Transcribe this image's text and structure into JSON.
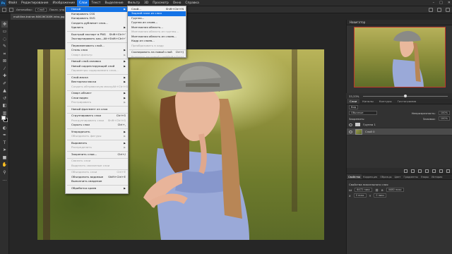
{
  "app": {
    "logo": "Ps"
  },
  "menubar": {
    "items": [
      "Файл",
      "Редактирование",
      "Изображение",
      "Слои",
      "Текст",
      "Выделение",
      "Фильтр",
      "3D",
      "Просмотр",
      "Окно",
      "Справка"
    ],
    "active_index": 3
  },
  "window_controls": [
    "–",
    "□",
    "✕"
  ],
  "options_bar": {
    "auto_select_label": "Автовыбор:",
    "auto_select_value": "Слой",
    "transform_label": "Показ. упр. элем."
  },
  "document_tab": {
    "title": "multiline-trainer-N0026CKXM-intro.jpg @ 33,3% (Слой 0, RGB/8#)"
  },
  "layer_menu": {
    "items": [
      {
        "label": "Новый",
        "shortcut": "",
        "submenu": true,
        "highlighted": true,
        "disabled": false
      },
      {
        "label": "Копировать CSS",
        "shortcut": "",
        "submenu": false,
        "highlighted": false,
        "disabled": false
      },
      {
        "label": "Копировать SVG",
        "shortcut": "",
        "submenu": false,
        "highlighted": false,
        "disabled": false
      },
      {
        "label": "Создать дубликат слоя...",
        "shortcut": "",
        "submenu": false,
        "highlighted": false,
        "disabled": false
      },
      {
        "label": "Удалить",
        "shortcut": "",
        "submenu": true,
        "highlighted": false,
        "disabled": false
      },
      {
        "sep": true
      },
      {
        "label": "Быстрый экспорт в PNG",
        "shortcut": "Shift+Ctrl+'",
        "submenu": false,
        "highlighted": false,
        "disabled": false
      },
      {
        "label": "Экспортировать как...",
        "shortcut": "Alt+Shift+Ctrl+'",
        "submenu": false,
        "highlighted": false,
        "disabled": false
      },
      {
        "sep": true
      },
      {
        "label": "Переименовать слой...",
        "shortcut": "",
        "submenu": false,
        "highlighted": false,
        "disabled": false
      },
      {
        "label": "Стиль слоя",
        "shortcut": "",
        "submenu": true,
        "highlighted": false,
        "disabled": false
      },
      {
        "label": "Смарт-фильтр",
        "shortcut": "",
        "submenu": true,
        "highlighted": false,
        "disabled": true
      },
      {
        "sep": true
      },
      {
        "label": "Новый слой-заливка",
        "shortcut": "",
        "submenu": true,
        "highlighted": false,
        "disabled": false
      },
      {
        "label": "Новый корректирующий слой",
        "shortcut": "",
        "submenu": true,
        "highlighted": false,
        "disabled": false
      },
      {
        "label": "Параметры содержимого слоя...",
        "shortcut": "",
        "submenu": false,
        "highlighted": false,
        "disabled": true
      },
      {
        "sep": true
      },
      {
        "label": "Слой-маска",
        "shortcut": "",
        "submenu": true,
        "highlighted": false,
        "disabled": false
      },
      {
        "label": "Векторная маска",
        "shortcut": "",
        "submenu": true,
        "highlighted": false,
        "disabled": false
      },
      {
        "label": "Создать обтравочную маску",
        "shortcut": "Alt+Ctrl+G",
        "submenu": false,
        "highlighted": false,
        "disabled": true
      },
      {
        "sep": true
      },
      {
        "label": "Смарт-объект",
        "shortcut": "",
        "submenu": true,
        "highlighted": false,
        "disabled": false
      },
      {
        "label": "Слои видео",
        "shortcut": "",
        "submenu": true,
        "highlighted": false,
        "disabled": false
      },
      {
        "label": "Растрировать",
        "shortcut": "",
        "submenu": true,
        "highlighted": false,
        "disabled": true
      },
      {
        "sep": true
      },
      {
        "label": "Новый фрагмент из слоя",
        "shortcut": "",
        "submenu": false,
        "highlighted": false,
        "disabled": false
      },
      {
        "sep": true
      },
      {
        "label": "Сгруппировать слои",
        "shortcut": "Ctrl+G",
        "submenu": false,
        "highlighted": false,
        "disabled": false
      },
      {
        "label": "Разгруппировать слои",
        "shortcut": "Shift+Ctrl+G",
        "submenu": false,
        "highlighted": false,
        "disabled": true
      },
      {
        "label": "Скрыть слои",
        "shortcut": "Ctrl+,",
        "submenu": false,
        "highlighted": false,
        "disabled": false
      },
      {
        "sep": true
      },
      {
        "label": "Упорядочить",
        "shortcut": "",
        "submenu": true,
        "highlighted": false,
        "disabled": false
      },
      {
        "label": "Объединить фигуры",
        "shortcut": "",
        "submenu": true,
        "highlighted": false,
        "disabled": true
      },
      {
        "sep": true
      },
      {
        "label": "Выровнять",
        "shortcut": "",
        "submenu": true,
        "highlighted": false,
        "disabled": false
      },
      {
        "label": "Распределить",
        "shortcut": "",
        "submenu": true,
        "highlighted": false,
        "disabled": true
      },
      {
        "sep": true
      },
      {
        "label": "Закрепить слои...",
        "shortcut": "Ctrl+/",
        "submenu": false,
        "highlighted": false,
        "disabled": false
      },
      {
        "sep": true
      },
      {
        "label": "Связать слои",
        "shortcut": "",
        "submenu": false,
        "highlighted": false,
        "disabled": true
      },
      {
        "label": "Выделить связанные слои",
        "shortcut": "",
        "submenu": false,
        "highlighted": false,
        "disabled": true
      },
      {
        "sep": true
      },
      {
        "label": "Объединить слои",
        "shortcut": "Ctrl+E",
        "submenu": false,
        "highlighted": false,
        "disabled": true
      },
      {
        "label": "Объединить видимые",
        "shortcut": "Shift+Ctrl+E",
        "submenu": false,
        "highlighted": false,
        "disabled": false
      },
      {
        "label": "Выполнить сведение",
        "shortcut": "",
        "submenu": false,
        "highlighted": false,
        "disabled": false
      },
      {
        "sep": true
      },
      {
        "label": "Обработка краев",
        "shortcut": "",
        "submenu": true,
        "highlighted": false,
        "disabled": false
      }
    ]
  },
  "new_submenu": {
    "items": [
      {
        "label": "Слой...",
        "shortcut": "Shift+Ctrl+N",
        "highlighted": false,
        "disabled": false
      },
      {
        "label": "Задний план из слоя",
        "shortcut": "",
        "highlighted": true,
        "disabled": false
      },
      {
        "label": "Группа...",
        "shortcut": "",
        "highlighted": false,
        "disabled": false
      },
      {
        "label": "Группа из слоев...",
        "shortcut": "",
        "highlighted": false,
        "disabled": false
      },
      {
        "label": "Монтажная область...",
        "shortcut": "",
        "highlighted": false,
        "disabled": false
      },
      {
        "label": "Монтажная область из группы...",
        "shortcut": "",
        "highlighted": false,
        "disabled": true
      },
      {
        "label": "Монтажная область из слоев...",
        "shortcut": "",
        "highlighted": false,
        "disabled": false
      },
      {
        "label": "Кадр из слоев...",
        "shortcut": "",
        "highlighted": false,
        "disabled": false
      },
      {
        "label": "Преобразовать в кадр",
        "shortcut": "",
        "highlighted": false,
        "disabled": true
      },
      {
        "sep": true
      },
      {
        "label": "Скопировать на новый слой",
        "shortcut": "Ctrl+J",
        "highlighted": false,
        "disabled": false
      },
      {
        "label": "Вырезать на новый слой",
        "shortcut": "Shift+Ctrl+J",
        "highlighted": false,
        "disabled": true
      }
    ]
  },
  "navigator": {
    "title": "Навигатор",
    "zoom": "33,33%"
  },
  "layers_panel": {
    "tabs": [
      "Слои",
      "Каналы",
      "Контуры",
      "Гистограмма"
    ],
    "active_tab": 0,
    "kind_filter": "Вид",
    "blend_mode": "Обычные",
    "opacity_label": "Непрозрачность:",
    "opacity_value": "100%",
    "lock_label": "Закрепить:",
    "fill_label": "Заливка:",
    "fill_value": "100%",
    "layers": [
      {
        "name": "Группа 1",
        "type": "group",
        "selected": false
      },
      {
        "name": "Слой 0",
        "type": "pixel",
        "selected": true
      }
    ]
  },
  "properties_panel": {
    "tabs": [
      "Свойства",
      "Коррекция",
      "Образцы",
      "Цвет",
      "Градиенты",
      "Узоры",
      "История"
    ],
    "active_tab": 0,
    "subtitle": "Свойства пиксельного слоя",
    "w_label": "Ш",
    "w_value": "6472 пикс",
    "h_label": "В",
    "h_value": "4480 пикс",
    "x_label": "X",
    "x_value": "0 пикс",
    "y_label": "Y",
    "y_value": "0 пикс"
  }
}
